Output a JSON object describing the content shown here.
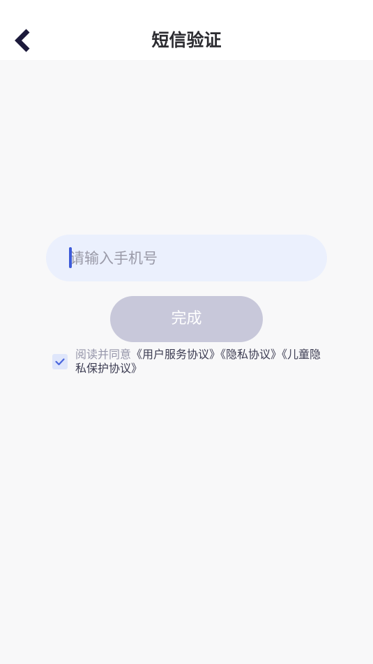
{
  "header": {
    "title": "短信验证",
    "back_icon": "chevron-left-icon"
  },
  "form": {
    "phone_placeholder": "请输入手机号",
    "phone_value": "",
    "submit_label": "完成"
  },
  "agreement": {
    "checked": true,
    "prefix": "阅读并同意",
    "links": [
      "《用户服务协议》",
      "《隐私协议》",
      "《儿童隐私保护协议》"
    ]
  },
  "colors": {
    "background": "#f8f8f9",
    "input_background": "#ebf0fd",
    "accent": "#3d5bd9",
    "button_disabled": "#c8c8da",
    "title_text": "#2b2b30"
  }
}
